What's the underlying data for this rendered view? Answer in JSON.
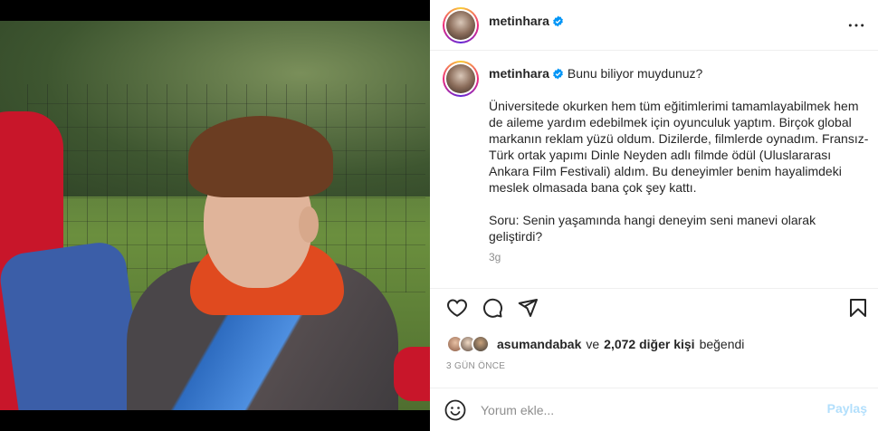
{
  "post": {
    "username": "metinhara",
    "verified": true,
    "caption": {
      "first_line": "Bunu biliyor muydunuz?",
      "body": "Üniversitede okurken hem tüm eğitimlerimi tamamlayabilmek hem de aileme yardım edebilmek için oyunculuk yaptım. Birçok global markanın reklam yüzü oldum. Dizilerde, filmlerde oynadım. Fransız-Türk ortak yapımı Dinle Neyden adlı filmde ödül (Uluslararası Ankara Film Festivali) aldım. Bu deneyimler benim hayalimdeki meslek olmasada bana çok şey kattı.\n\nSoru: Senin yaşamında hangi deneyim seni manevi olarak geliştirdi?",
      "time": "3g"
    },
    "likes": {
      "first_liker": "asumandabak",
      "connector": "ve",
      "others_count": "2,072 diğer kişi",
      "suffix": "beğendi"
    },
    "date": "3 GÜN ÖNCE"
  },
  "comment": {
    "placeholder": "Yorum ekle...",
    "post_label": "Paylaş"
  },
  "icons": {
    "more": "more-options-icon",
    "like": "heart-icon",
    "comment": "comment-icon",
    "share": "share-icon",
    "save": "bookmark-icon",
    "emoji": "emoji-icon",
    "verified": "verified-badge-icon"
  },
  "colors": {
    "verified": "#0095f6",
    "post_button_disabled": "#b2dffc",
    "secondary_text": "#8e8e8e"
  }
}
